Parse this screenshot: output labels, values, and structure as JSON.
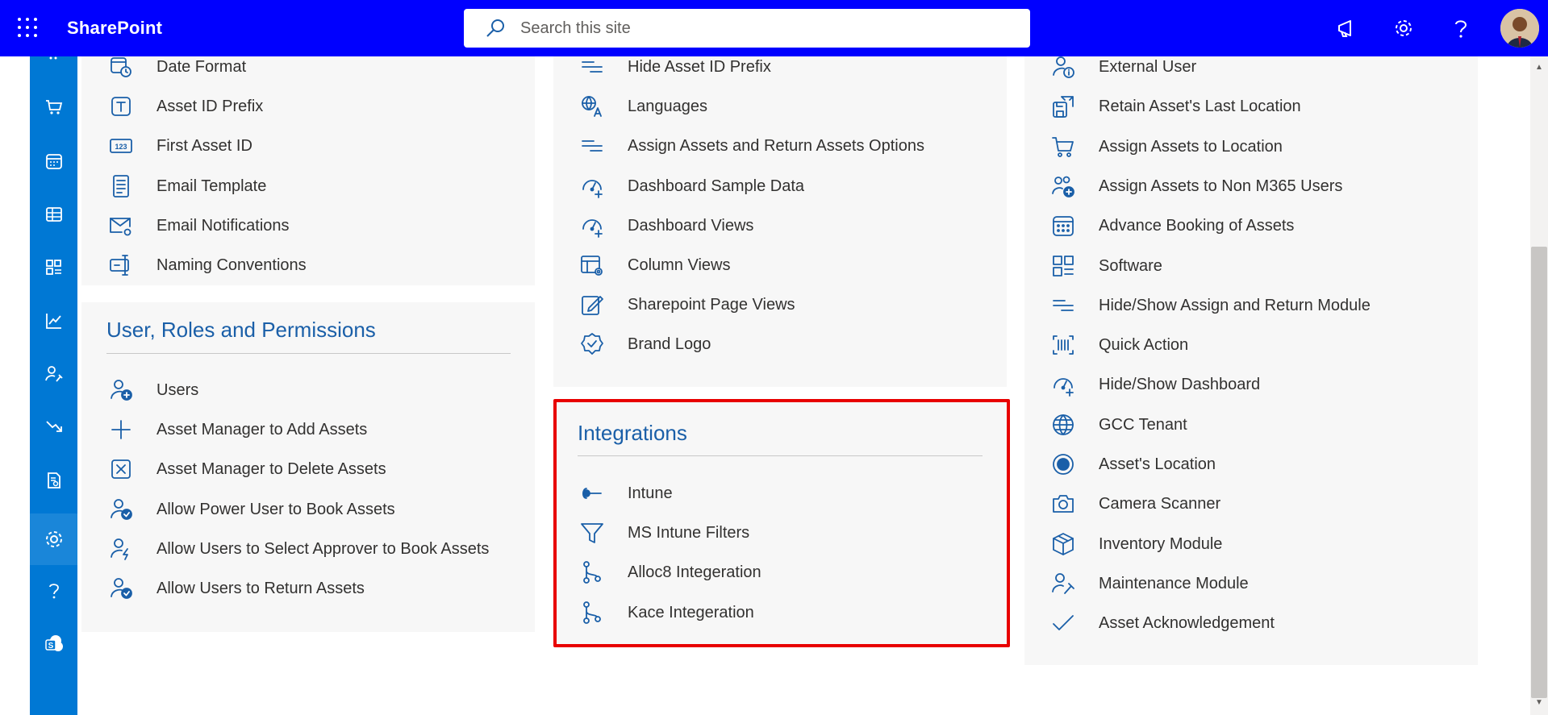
{
  "header": {
    "brand": "SharePoint",
    "search_placeholder": "Search this site"
  },
  "icons": {
    "app_launcher": "waffle-icon",
    "search": "search-icon",
    "feedback": "megaphone-icon",
    "settings": "gear-icon",
    "help": "help-icon"
  },
  "left_panel": {
    "items_top": [
      {
        "label": "Date Format",
        "icon": "calendar-clock-icon"
      },
      {
        "label": "Asset ID Prefix",
        "icon": "text-box-icon"
      },
      {
        "label": "First Asset ID",
        "icon": "number-box-icon"
      },
      {
        "label": "Email Template",
        "icon": "document-list-icon"
      },
      {
        "label": "Email Notifications",
        "icon": "mail-settings-icon"
      },
      {
        "label": "Naming Conventions",
        "icon": "rename-icon"
      }
    ],
    "section_title": "User, Roles and Permissions",
    "items_bottom": [
      {
        "label": "Users",
        "icon": "person-add-icon"
      },
      {
        "label": "Asset Manager to Add Assets",
        "icon": "plus-icon"
      },
      {
        "label": "Asset Manager to Delete Assets",
        "icon": "delete-box-icon"
      },
      {
        "label": "Allow Power User to Book Assets",
        "icon": "person-check-icon"
      },
      {
        "label": "Allow Users to Select Approver to Book Assets",
        "icon": "person-bolt-icon"
      },
      {
        "label": "Allow Users to Return Assets",
        "icon": "person-check-icon"
      }
    ]
  },
  "middle_panel": {
    "items": [
      {
        "label": "Hide Asset ID Prefix",
        "icon": "lines-icon"
      },
      {
        "label": "Languages",
        "icon": "translate-icon"
      },
      {
        "label": "Assign Assets and Return Assets Options",
        "icon": "lines-icon"
      },
      {
        "label": "Dashboard Sample Data",
        "icon": "gauge-add-icon"
      },
      {
        "label": "Dashboard Views",
        "icon": "gauge-add-icon"
      },
      {
        "label": "Column Views",
        "icon": "table-settings-icon"
      },
      {
        "label": "Sharepoint Page Views",
        "icon": "edit-page-icon"
      },
      {
        "label": "Brand Logo",
        "icon": "badge-check-icon"
      }
    ]
  },
  "integrations": {
    "title": "Integrations",
    "items": [
      {
        "label": "Intune",
        "icon": "key-icon"
      },
      {
        "label": "MS Intune Filters",
        "icon": "filter-icon"
      },
      {
        "label": "Alloc8 Integeration",
        "icon": "branch-icon"
      },
      {
        "label": "Kace Integeration",
        "icon": "branch-icon"
      }
    ]
  },
  "right_panel": {
    "items": [
      {
        "label": "External User",
        "icon": "person-info-icon"
      },
      {
        "label": "Retain Asset's Last Location",
        "icon": "save-arrows-icon"
      },
      {
        "label": "Assign Assets to Location",
        "icon": "cart-icon"
      },
      {
        "label": "Assign Assets to Non M365 Users",
        "icon": "people-add-icon"
      },
      {
        "label": "Advance Booking of Assets",
        "icon": "calendar-icon"
      },
      {
        "label": "Software",
        "icon": "apps-icon"
      },
      {
        "label": "Hide/Show Assign and Return Module",
        "icon": "lines-icon"
      },
      {
        "label": "Quick Action",
        "icon": "barcode-icon"
      },
      {
        "label": "Hide/Show Dashboard",
        "icon": "gauge-add-icon"
      },
      {
        "label": "GCC Tenant",
        "icon": "globe-icon"
      },
      {
        "label": "Asset's Location",
        "icon": "radio-icon"
      },
      {
        "label": "Camera Scanner",
        "icon": "camera-icon"
      },
      {
        "label": "Inventory Module",
        "icon": "box-icon"
      },
      {
        "label": "Maintenance Module",
        "icon": "person-wrench-icon"
      },
      {
        "label": "Asset Acknowledgement",
        "icon": "checkmark-icon"
      }
    ]
  },
  "colors": {
    "header": "#0000ff",
    "rail": "#0078d4",
    "accent": "#1a5fa8",
    "highlight": "#e80000"
  }
}
